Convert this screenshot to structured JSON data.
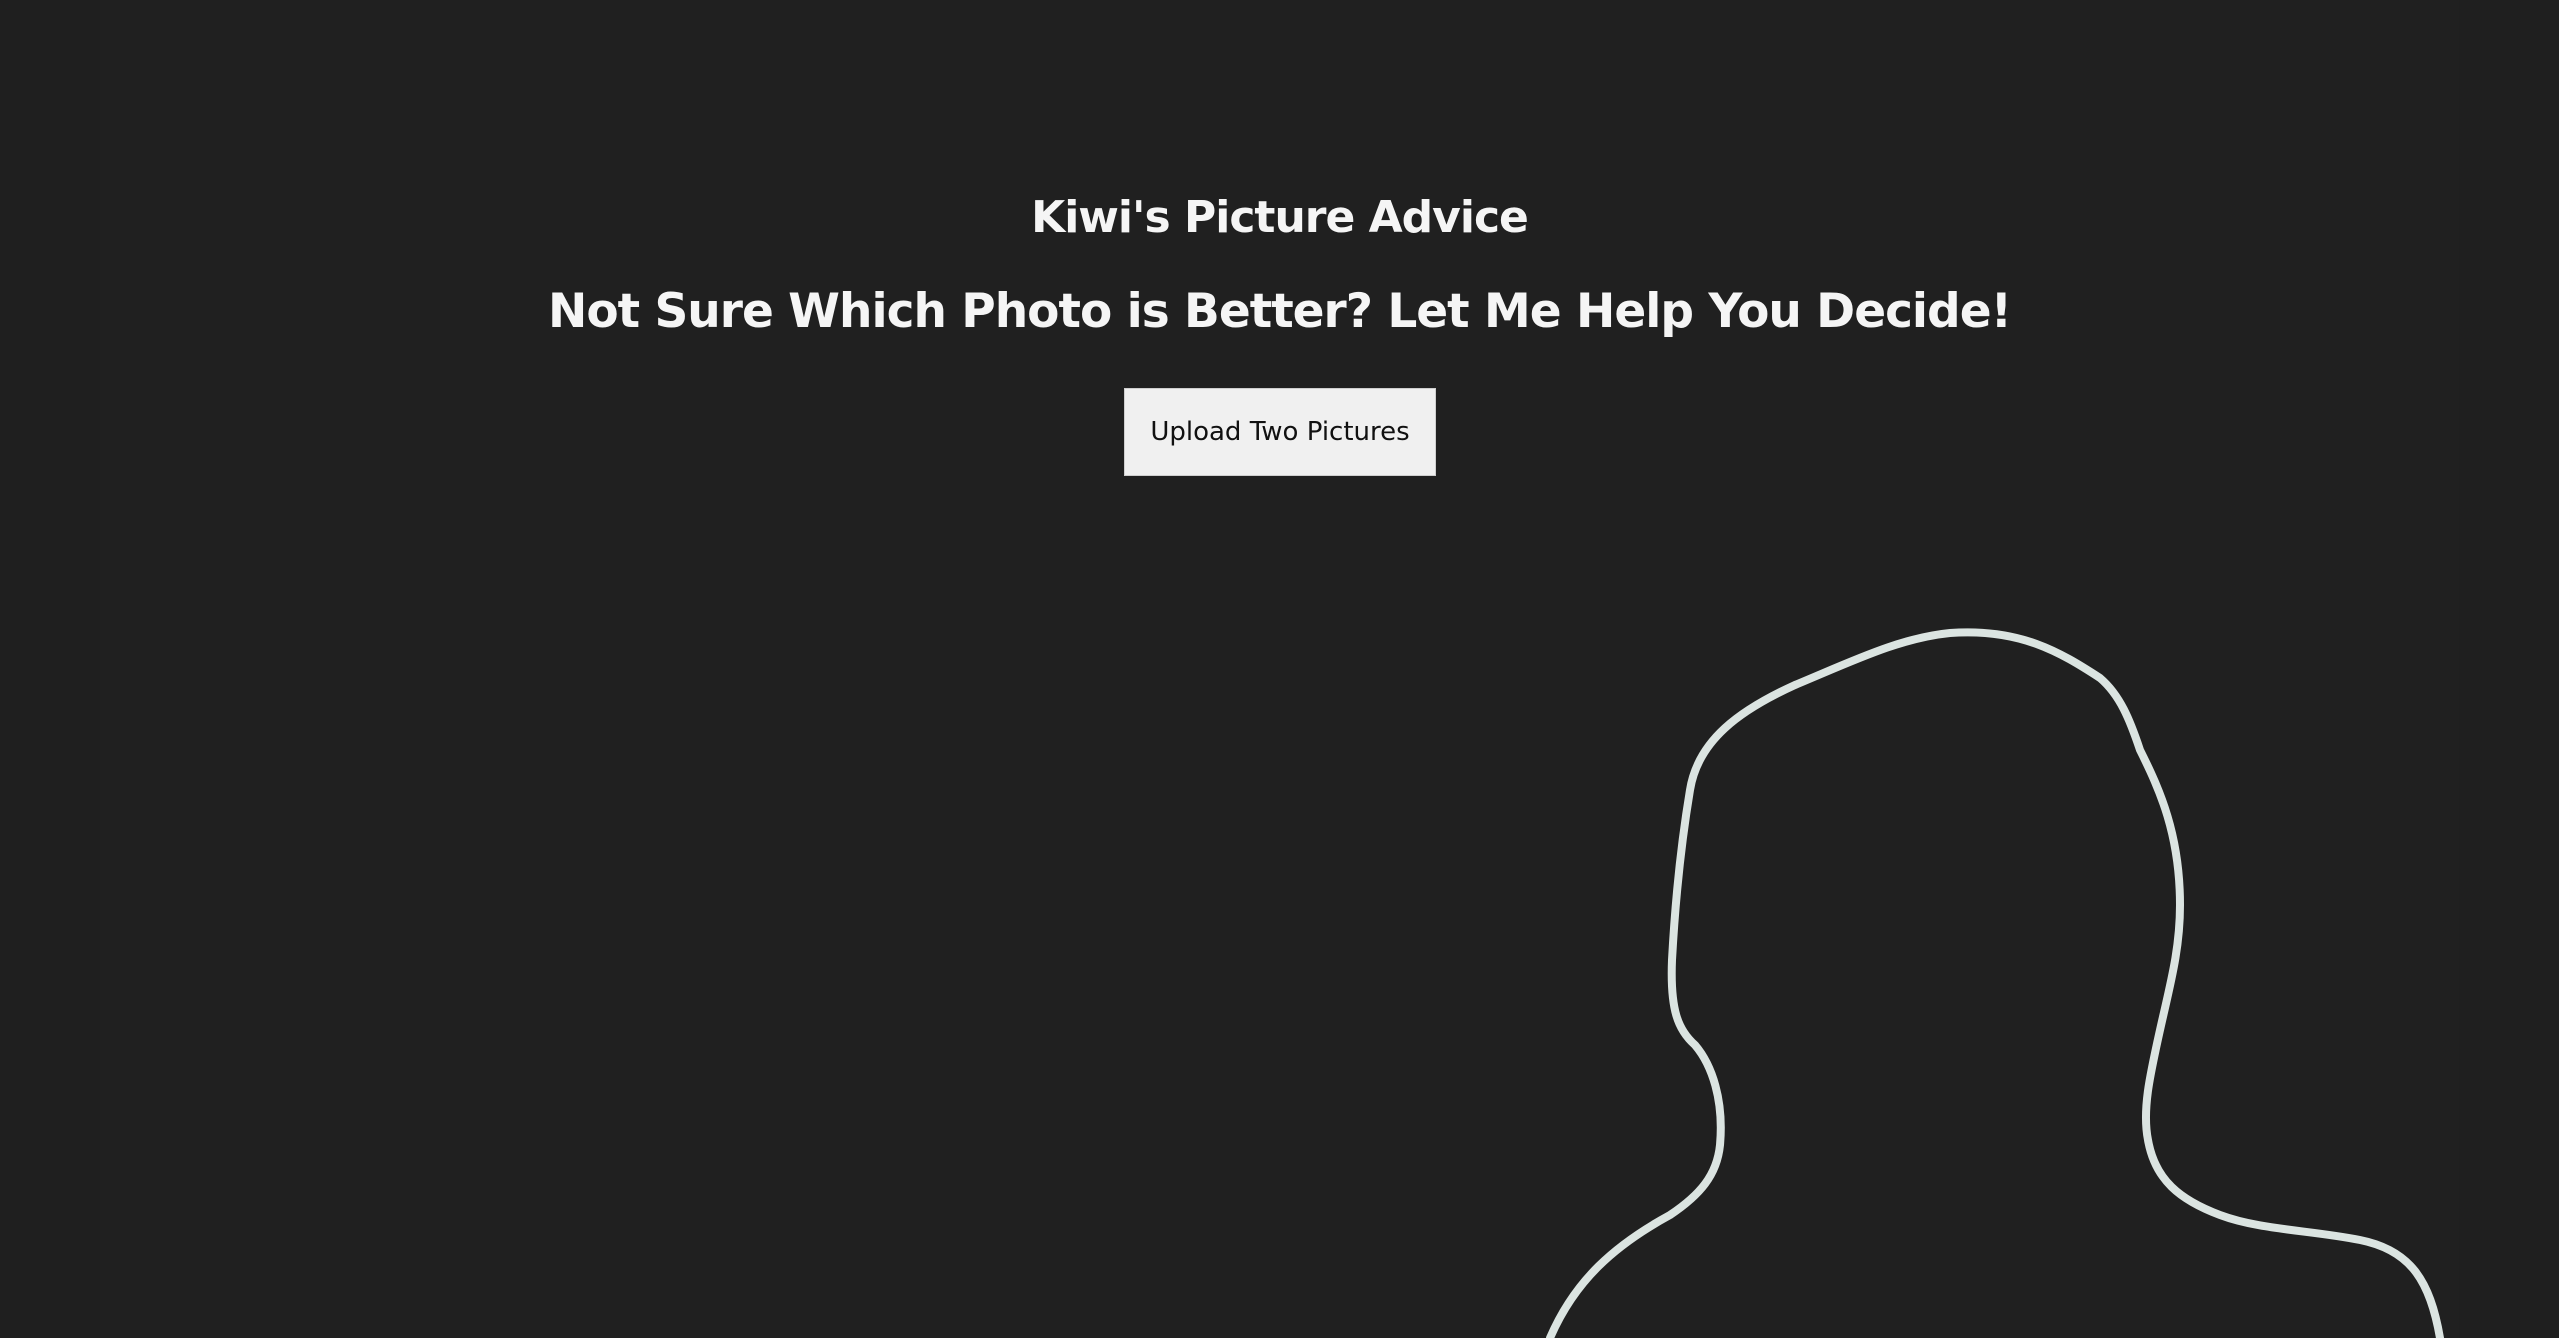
{
  "page": {
    "title": "Kiwi's Picture Advice",
    "subtitle": "Not Sure Which Photo is Better? Let Me Help You Decide!"
  },
  "actions": {
    "upload_label": "Upload Two Pictures"
  },
  "colors": {
    "background": "#202020",
    "text": "#f5f5f5",
    "button_background": "#f0f0f0",
    "button_text": "#111111",
    "outline": "#dbe4e1"
  },
  "icons": {
    "silhouette": "person-silhouette-icon"
  }
}
